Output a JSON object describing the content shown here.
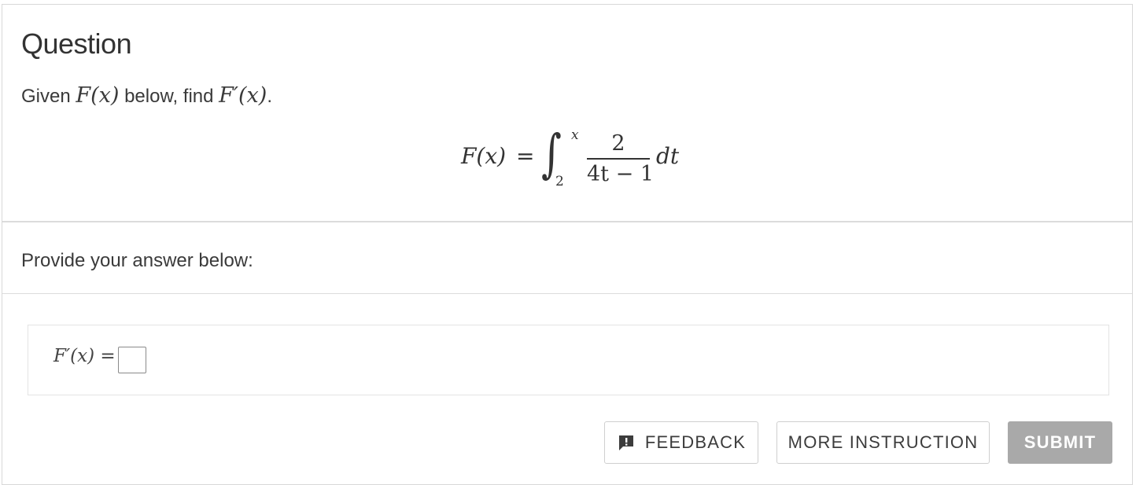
{
  "question": {
    "title": "Question",
    "prompt_prefix": "Given ",
    "prompt_fx": "F(x)",
    "prompt_middle": " below, find ",
    "prompt_fpx": "F′(x)",
    "prompt_suffix": "."
  },
  "formula": {
    "lhs": "F(x)",
    "equals": "=",
    "integral_symbol": "∫",
    "upper_limit": "x",
    "lower_limit": "2",
    "numerator": "2",
    "denominator": "4t − 1",
    "differential": "dt"
  },
  "answer": {
    "prompt": "Provide your answer below:",
    "label": "F′(x) =",
    "input_value": ""
  },
  "buttons": {
    "feedback_label": "FEEDBACK",
    "feedback_icon": "feedback-icon",
    "more_instruction_label": "MORE INSTRUCTION",
    "submit_label": "SUBMIT"
  },
  "colors": {
    "text": "#333333",
    "border": "#d8d8d8",
    "submit_bg": "#a9a9a9",
    "submit_text": "#ffffff"
  }
}
